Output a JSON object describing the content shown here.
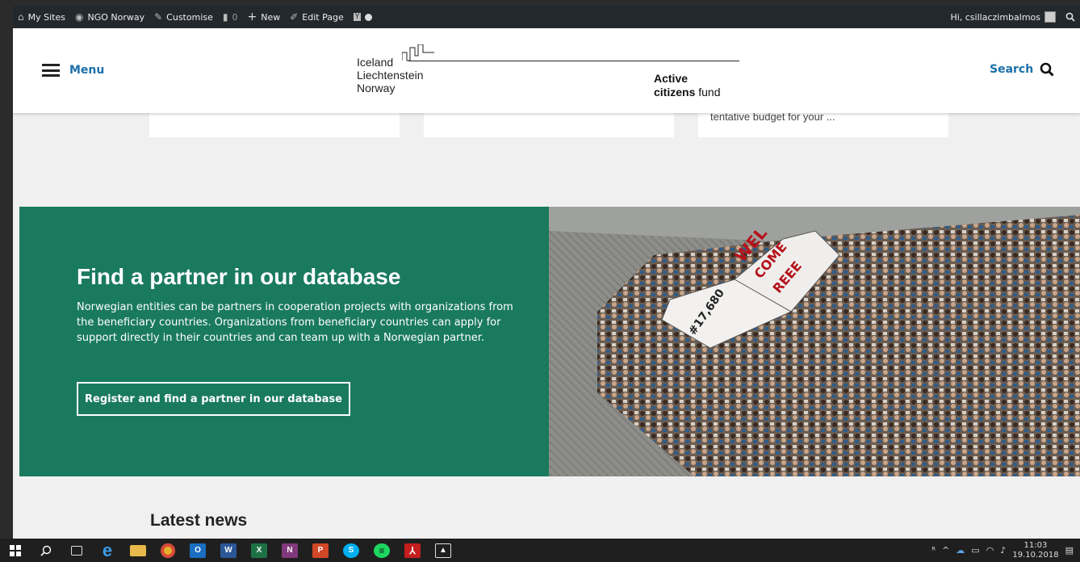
{
  "adminbar": {
    "items": [
      {
        "icon": "wordpress-icon",
        "label": "My Sites"
      },
      {
        "icon": "home-icon",
        "label": "NGO Norway"
      },
      {
        "icon": "brush-icon",
        "label": "Customise"
      },
      {
        "icon": "comment-icon",
        "label": "0"
      },
      {
        "icon": "plus-icon",
        "label": "New"
      },
      {
        "icon": "pencil-icon",
        "label": "Edit Page"
      }
    ],
    "greeting": "Hi, csillaczimbalmos"
  },
  "header": {
    "menu_label": "Menu",
    "search_label": "Search",
    "logo": {
      "countries": [
        "Iceland",
        "Liechtenstein",
        "Norway"
      ],
      "fund_line1": "Active",
      "fund_line2_bold": "citizens",
      "fund_line2": " fund"
    }
  },
  "cards": [
    {
      "text": ""
    },
    {
      "text": ""
    },
    {
      "text": "tentative budget for your ..."
    }
  ],
  "partner": {
    "title": "Find a partner in our database",
    "text": "Norwegian entities can be partners in cooperation projects with organizations from the beneficiary countries. Organizations from beneficiary countries can apply for support directly in their countries and can team up with a Norwegian partner.",
    "button_label": "Register and find a partner in our database",
    "photo_sign": [
      "WEL",
      "COME",
      "REEE"
    ],
    "photo_tag": "#17,680"
  },
  "news": {
    "heading": "Latest news"
  },
  "taskbar": {
    "time": "11:03",
    "date": "19.10.2018",
    "apps": [
      "O",
      "W",
      "X",
      "N",
      "P",
      "S"
    ]
  },
  "colors": {
    "green": "#1a7a5e",
    "link_blue": "#1a6fa8",
    "adminbar": "#23282d"
  }
}
